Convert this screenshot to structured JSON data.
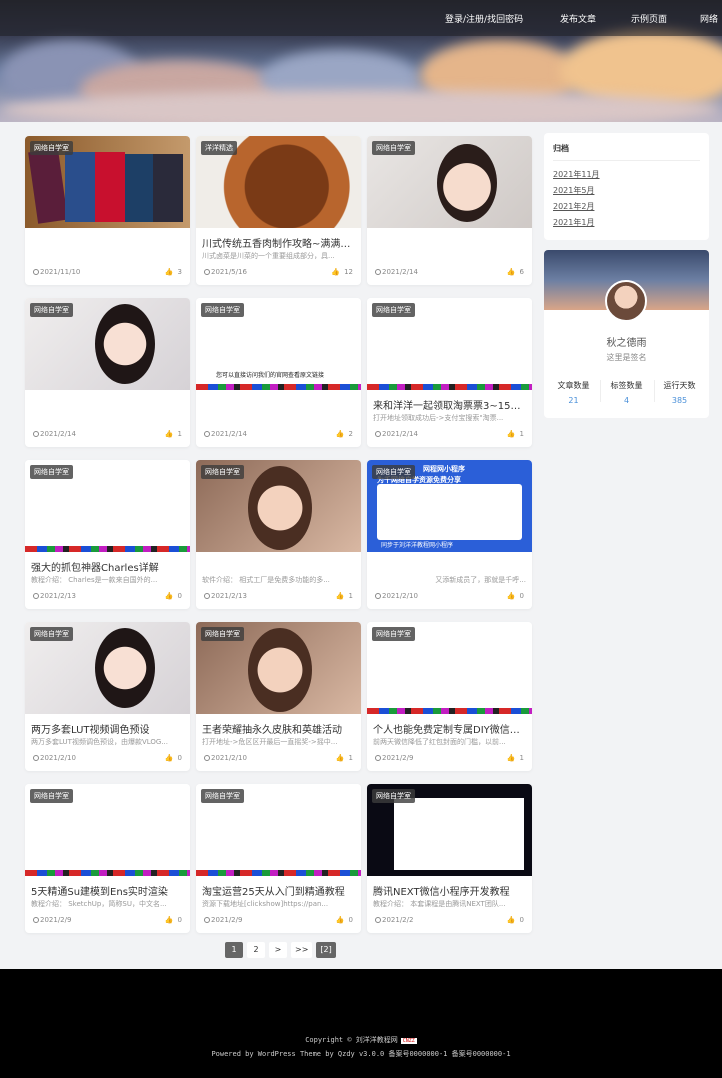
{
  "nav": {
    "login": "登录/注册/找回密码",
    "publish": "发布文章",
    "example": "示例页面",
    "more": "网络"
  },
  "cards": [
    {
      "tag": "网络自学室",
      "title": "",
      "excerpt": "",
      "date": "2021/11/10",
      "likes": "3"
    },
    {
      "tag": "洋洋精选",
      "title": "川式传统五香肉制作攻略~满满干...",
      "excerpt": "川式卤菜是川菜的一个重要组成部分，具...",
      "date": "2021/5/16",
      "likes": "12"
    },
    {
      "tag": "网络自学室",
      "title": "",
      "excerpt": "",
      "date": "2021/2/14",
      "likes": "6"
    },
    {
      "tag": "网络自学室",
      "title": "",
      "excerpt": "",
      "date": "2021/2/14",
      "likes": "1"
    },
    {
      "tag": "网络自学室",
      "title": "",
      "excerpt": "",
      "date": "2021/2/14",
      "likes": "2",
      "thumb_text": "您可以直接访问我们的官网查看原文链接"
    },
    {
      "tag": "网络自学室",
      "title": "来和洋洋一起领取淘票票3~15元...",
      "excerpt": "打开地址领取成功后->支付宝搜索\"淘票...",
      "date": "2021/2/14",
      "likes": "1"
    },
    {
      "tag": "网络自学室",
      "title": "强大的抓包神器Charles详解",
      "excerpt": "教程介绍： Charles是一款来自国外的...",
      "date": "2021/2/13",
      "likes": "0"
    },
    {
      "tag": "网络自学室",
      "title": "",
      "excerpt": "软件介绍： 相式工厂是免费多功能的多...",
      "date": "2021/2/13",
      "likes": "1"
    },
    {
      "tag": "网络自学室",
      "title": "",
      "excerpt": "又添新成员了，那就是千呼...",
      "date": "2021/2/10",
      "likes": "0",
      "thumb_text_top": "网程网小程序",
      "thumb_text_top2": "为千网络自学资源免费分享",
      "thumb_text_bottom": "同步于刘洋洋教程网小程序"
    },
    {
      "tag": "网络自学室",
      "title": "两万多套LUT视频调色预设",
      "excerpt": "两万多套LUT视频调色预设，由爆款VLOG...",
      "date": "2021/2/10",
      "likes": "0"
    },
    {
      "tag": "网络自学室",
      "title": "王者荣耀抽永久皮肤和英雄活动",
      "excerpt": "打开地址->危区区开最后一直摇奖->摇中...",
      "date": "2021/2/10",
      "likes": "1"
    },
    {
      "tag": "网络自学室",
      "title": "个人也能免费定制专属DIY微信红...",
      "excerpt": "前两天微信降低了红包封面的门槛，以前...",
      "date": "2021/2/9",
      "likes": "1"
    },
    {
      "tag": "网络自学室",
      "title": "5天精通Su建模到Ens实时渲染",
      "excerpt": "教程介绍： SketchUp，简称SU，中文名...",
      "date": "2021/2/9",
      "likes": "0"
    },
    {
      "tag": "网络自学室",
      "title": "淘宝运营25天从入门到精通教程",
      "excerpt": "资源下载地址[clickshow]https://pan...",
      "date": "2021/2/9",
      "likes": "0"
    },
    {
      "tag": "网络自学室",
      "title": "腾讯NEXT微信小程序开发教程",
      "excerpt": "教程介绍： 本套课程是由腾讯NEXT团队...",
      "date": "2021/2/2",
      "likes": "0"
    }
  ],
  "sidebar": {
    "archive_title": "归档",
    "archive_items": [
      "2021年11月",
      "2021年5月",
      "2021年2月",
      "2021年1月"
    ],
    "profile": {
      "name": "秋之德雨",
      "signature": "这里是签名",
      "stats": [
        {
          "label": "文章数量",
          "value": "21"
        },
        {
          "label": "标签数量",
          "value": "4"
        },
        {
          "label": "运行天数",
          "value": "385"
        }
      ]
    }
  },
  "pagination": {
    "pages": [
      "1",
      "2",
      ">",
      ">>",
      "[2]"
    ]
  },
  "footer": {
    "copyright": "Copyright © 刘洋洋教程网",
    "cnzz": "CNZZ",
    "powered": "Powered by WordPress Theme by Qzdy v3.0.0 备案号0000000-1 备案号0000000-1"
  }
}
